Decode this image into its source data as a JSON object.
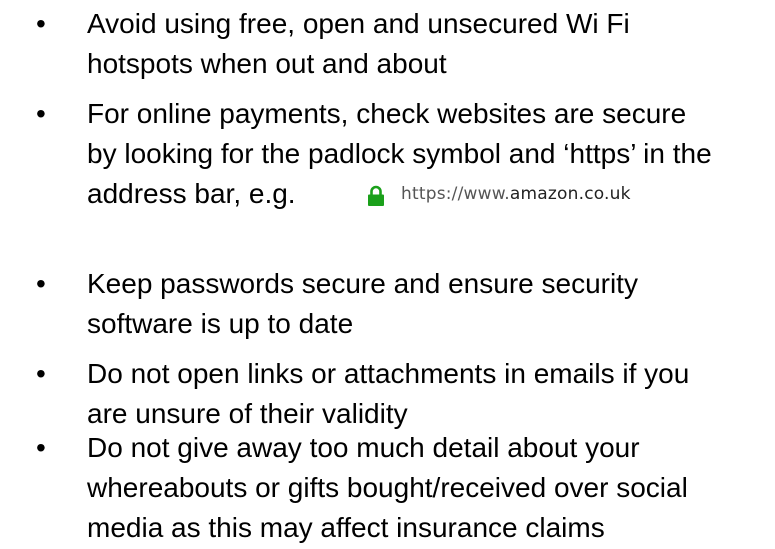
{
  "bullet_glyph": "•",
  "items": [
    {
      "lines": [
        "Avoid using free, open and unsecured Wi Fi",
        "hotspots when out and about"
      ]
    },
    {
      "lines": [
        "For online payments, check websites are secure",
        "by looking for the padlock symbol and ‘https’ in the",
        "address bar, e.g."
      ],
      "url_scheme": "https://www.",
      "url_domain": "amazon.co.uk",
      "padlock_color": "#1aa01a"
    },
    {
      "lines": [
        "Keep passwords secure and ensure security",
        "software is up to date"
      ]
    },
    {
      "lines": [
        "Do not open links or attachments in emails if you",
        "are unsure of their validity"
      ]
    },
    {
      "lines": [
        "Do not give away too much detail about your",
        "whereabouts or gifts bought/received over social",
        "media as this may affect insurance claims"
      ]
    }
  ]
}
